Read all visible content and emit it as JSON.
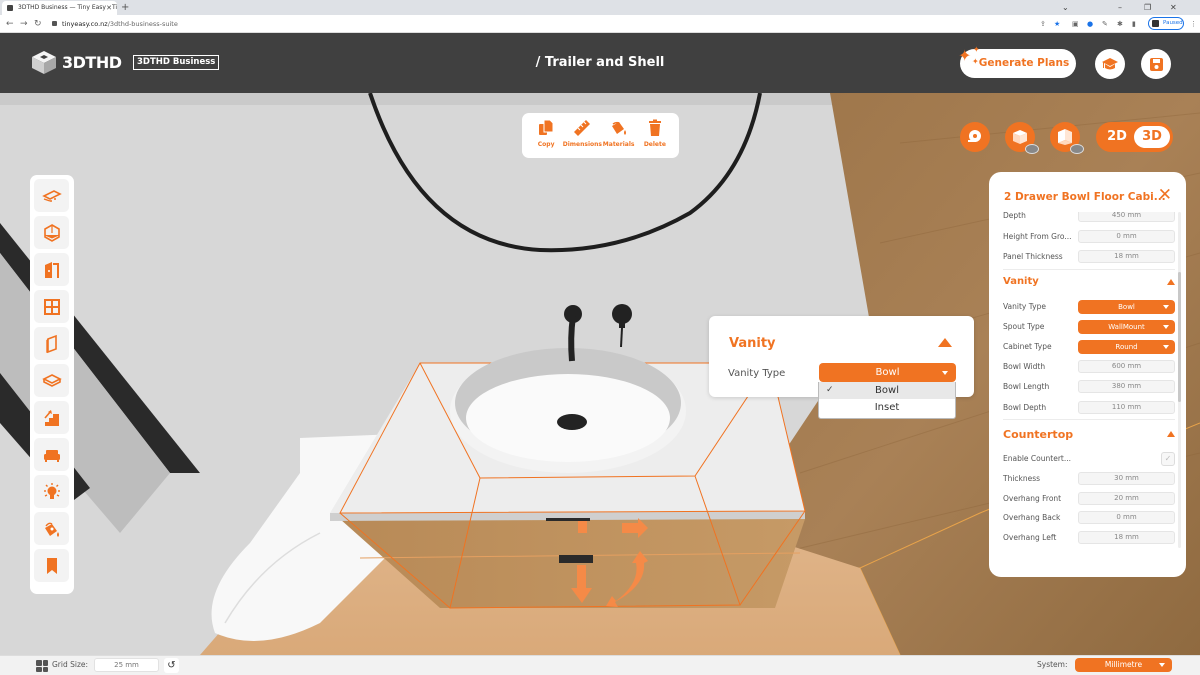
{
  "browser": {
    "tab_title": "3DTHD Business — Tiny Easy - Ti",
    "url_domain": "tinyeasy.co.nz",
    "url_path": "/3dthd-business-suite",
    "profile_status": "Paused"
  },
  "header": {
    "logo_text": "3DTHD",
    "badge": "3DTHD Business",
    "title": "/ Trailer and Shell",
    "generate_label": "Generate Plans",
    "help_icon": "graduation-cap-icon",
    "save_icon": "floppy-disk-icon"
  },
  "actions": [
    {
      "label": "Copy",
      "icon": "copy-icon"
    },
    {
      "label": "Dimensions",
      "icon": "ruler-icon"
    },
    {
      "label": "Materials",
      "icon": "paint-bucket-icon"
    },
    {
      "label": "Delete",
      "icon": "trash-icon"
    }
  ],
  "view_controls": {
    "measure_icon": "tape-measure-icon",
    "toggle_top_icon": "box-top-visibility-icon",
    "toggle_walls_icon": "box-walls-visibility-icon",
    "mode_2d": "2D",
    "mode_3d": "3D",
    "active_mode": "3D"
  },
  "left_toolbar": [
    {
      "name": "trailer",
      "icon": "trailer-icon"
    },
    {
      "name": "shell",
      "icon": "cube-outline-icon"
    },
    {
      "name": "doors",
      "icon": "door-icon"
    },
    {
      "name": "windows",
      "icon": "window-icon"
    },
    {
      "name": "walls",
      "icon": "wall-panel-icon"
    },
    {
      "name": "floors",
      "icon": "floor-layer-icon"
    },
    {
      "name": "stairs",
      "icon": "stairs-icon"
    },
    {
      "name": "furniture",
      "icon": "sofa-icon"
    },
    {
      "name": "lighting",
      "icon": "lightbulb-icon"
    },
    {
      "name": "materials",
      "icon": "paint-bucket-icon"
    },
    {
      "name": "bookmarks",
      "icon": "bookmark-icon"
    }
  ],
  "vanity_popup": {
    "title": "Vanity",
    "field_label": "Vanity Type",
    "selected": "Bowl",
    "options": [
      "Bowl",
      "Inset"
    ]
  },
  "properties": {
    "title": "2 Drawer Bowl Floor Cabi...",
    "top_rows": [
      {
        "label": "Depth",
        "value": "450 mm"
      },
      {
        "label": "Height From Gro...",
        "value": "0 mm"
      },
      {
        "label": "Panel Thickness",
        "value": "18 mm"
      }
    ],
    "vanity": {
      "title": "Vanity",
      "selects": [
        {
          "label": "Vanity Type",
          "value": "Bowl"
        },
        {
          "label": "Spout Type",
          "value": "WallMount"
        },
        {
          "label": "Cabinet Type",
          "value": "Round"
        }
      ],
      "rows": [
        {
          "label": "Bowl Width",
          "value": "600 mm"
        },
        {
          "label": "Bowl Length",
          "value": "380 mm"
        },
        {
          "label": "Bowl Depth",
          "value": "110 mm"
        }
      ]
    },
    "countertop": {
      "title": "Countertop",
      "enable_label": "Enable Countert...",
      "enabled": true,
      "rows": [
        {
          "label": "Thickness",
          "value": "30 mm"
        },
        {
          "label": "Overhang Front",
          "value": "20 mm"
        },
        {
          "label": "Overhang Back",
          "value": "0 mm"
        },
        {
          "label": "Overhang Left",
          "value": "18 mm"
        }
      ]
    }
  },
  "footer": {
    "grid_label": "Grid Size:",
    "grid_value": "25 mm",
    "system_label": "System:",
    "system_value": "Millimetre"
  },
  "colors": {
    "accent": "#f07322",
    "header_bg": "#404040",
    "panel_bg": "#ffffff"
  }
}
